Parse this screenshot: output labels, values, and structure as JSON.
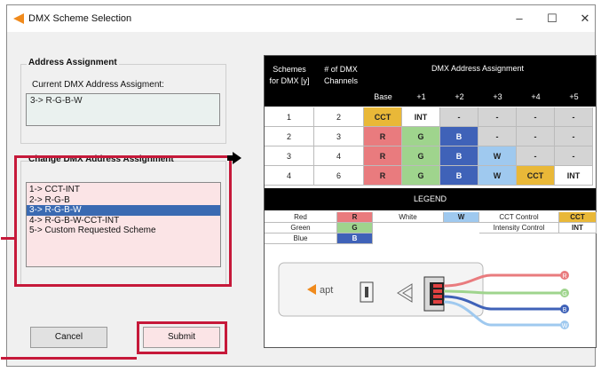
{
  "window": {
    "title": "DMX Scheme Selection",
    "minimize": "–",
    "maximize": "☐",
    "close": "✕"
  },
  "address_group": {
    "label": "Address Assignment",
    "current_label": "Current DMX Address Assigment:",
    "current_value": "3-> R-G-B-W"
  },
  "change_group": {
    "label": "Change DMX Address Assignment",
    "options": [
      "1-> CCT-INT",
      "2-> R-G-B",
      "3-> R-G-B-W",
      "4-> R-G-B-W-CCT-INT",
      "5-> Custom Requested Scheme"
    ],
    "selected_index": 2
  },
  "buttons": {
    "cancel": "Cancel",
    "submit": "Submit"
  },
  "colors": {
    "red": "#e97b7e",
    "green": "#9fd48d",
    "blue": "#3f62b8",
    "white": "#9fc9ef",
    "cct": "#e9b838",
    "gray": "#d4d4d4",
    "highlight": "#c6193a"
  },
  "table": {
    "headers": {
      "schemes": "Schemes for DMX [y]",
      "channels": "# of DMX Channels",
      "assignment": "DMX Address Assignment",
      "cols": [
        "Base",
        "+1",
        "+2",
        "+3",
        "+4",
        "+5"
      ]
    },
    "rows": [
      {
        "scheme": "1",
        "channels": "2",
        "cells": [
          "CCT",
          "INT",
          "-",
          "-",
          "-",
          "-"
        ]
      },
      {
        "scheme": "2",
        "channels": "3",
        "cells": [
          "R",
          "G",
          "B",
          "-",
          "-",
          "-"
        ]
      },
      {
        "scheme": "3",
        "channels": "4",
        "cells": [
          "R",
          "G",
          "B",
          "W",
          "-",
          "-"
        ]
      },
      {
        "scheme": "4",
        "channels": "6",
        "cells": [
          "R",
          "G",
          "B",
          "W",
          "CCT",
          "INT"
        ]
      }
    ]
  },
  "legend": {
    "title": "LEGEND",
    "items": [
      {
        "name": "Red",
        "code": "R"
      },
      {
        "name": "Green",
        "code": "G"
      },
      {
        "name": "Blue",
        "code": "B"
      },
      {
        "name": "White",
        "code": "W"
      },
      {
        "name": "CCT Control",
        "code": "CCT"
      },
      {
        "name": "Intensity Control",
        "code": "INT"
      }
    ]
  },
  "device": {
    "brand": "apt",
    "wire_labels": [
      "R",
      "G",
      "B",
      "W"
    ]
  }
}
